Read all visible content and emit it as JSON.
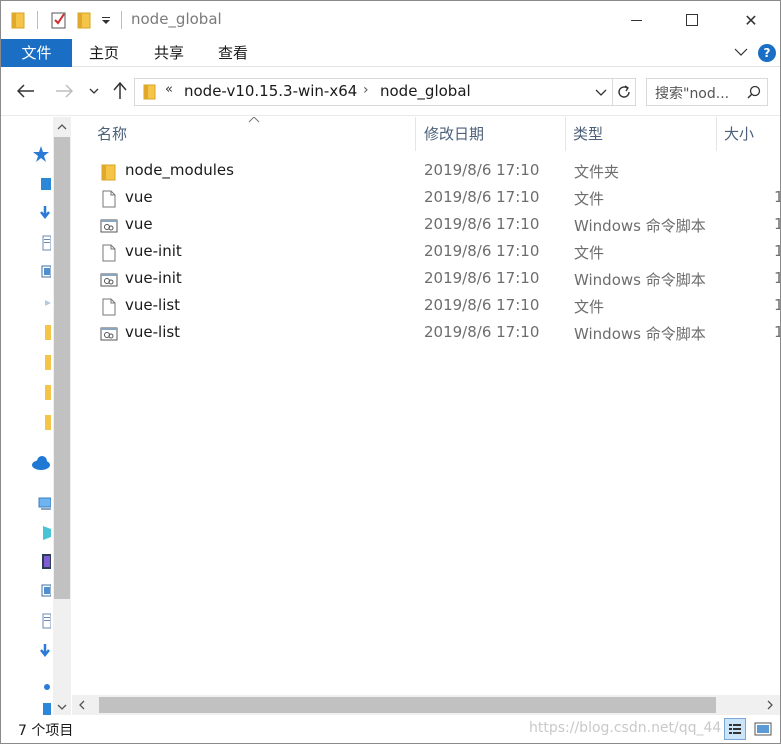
{
  "title_bar": {
    "title": "node_global",
    "minimize": "",
    "maximize": "",
    "close": "✕"
  },
  "ribbon": {
    "tabs": [
      {
        "label": "文件",
        "active": true
      },
      {
        "label": "主页"
      },
      {
        "label": "共享"
      },
      {
        "label": "查看"
      }
    ],
    "help": "?"
  },
  "navigation": {
    "breadcrumb_overflow": "«",
    "breadcrumbs": [
      "node-v10.15.3-win-x64",
      "node_global"
    ],
    "separator": "›",
    "search_placeholder": "搜索\"nod...",
    "icons": [
      "back-arrow-icon",
      "forward-arrow-icon",
      "recent-chevron-icon",
      "up-arrow-icon",
      "refresh-icon",
      "search-icon"
    ]
  },
  "columns": {
    "name": "名称",
    "date": "修改日期",
    "type": "类型",
    "size": "大小"
  },
  "files": [
    {
      "name": "node_modules",
      "date": "2019/8/6 17:10",
      "type": "文件夹",
      "size": "",
      "icon": "folder-icon"
    },
    {
      "name": "vue",
      "date": "2019/8/6 17:10",
      "type": "文件",
      "size": "1",
      "icon": "file-icon"
    },
    {
      "name": "vue",
      "date": "2019/8/6 17:10",
      "type": "Windows 命令脚本",
      "size": "1",
      "icon": "script-icon"
    },
    {
      "name": "vue-init",
      "date": "2019/8/6 17:10",
      "type": "文件",
      "size": "1",
      "icon": "file-icon"
    },
    {
      "name": "vue-init",
      "date": "2019/8/6 17:10",
      "type": "Windows 命令脚本",
      "size": "1",
      "icon": "script-icon"
    },
    {
      "name": "vue-list",
      "date": "2019/8/6 17:10",
      "type": "文件",
      "size": "1",
      "icon": "file-icon"
    },
    {
      "name": "vue-list",
      "date": "2019/8/6 17:10",
      "type": "Windows 命令脚本",
      "size": "1",
      "icon": "script-icon"
    }
  ],
  "status": {
    "item_count": "7 个项目",
    "watermark": "https://blog.csdn.net/qq_44"
  },
  "colors": {
    "accent": "#1a6fc4",
    "folder": "#f5c54a",
    "header_text": "#4c607a"
  }
}
